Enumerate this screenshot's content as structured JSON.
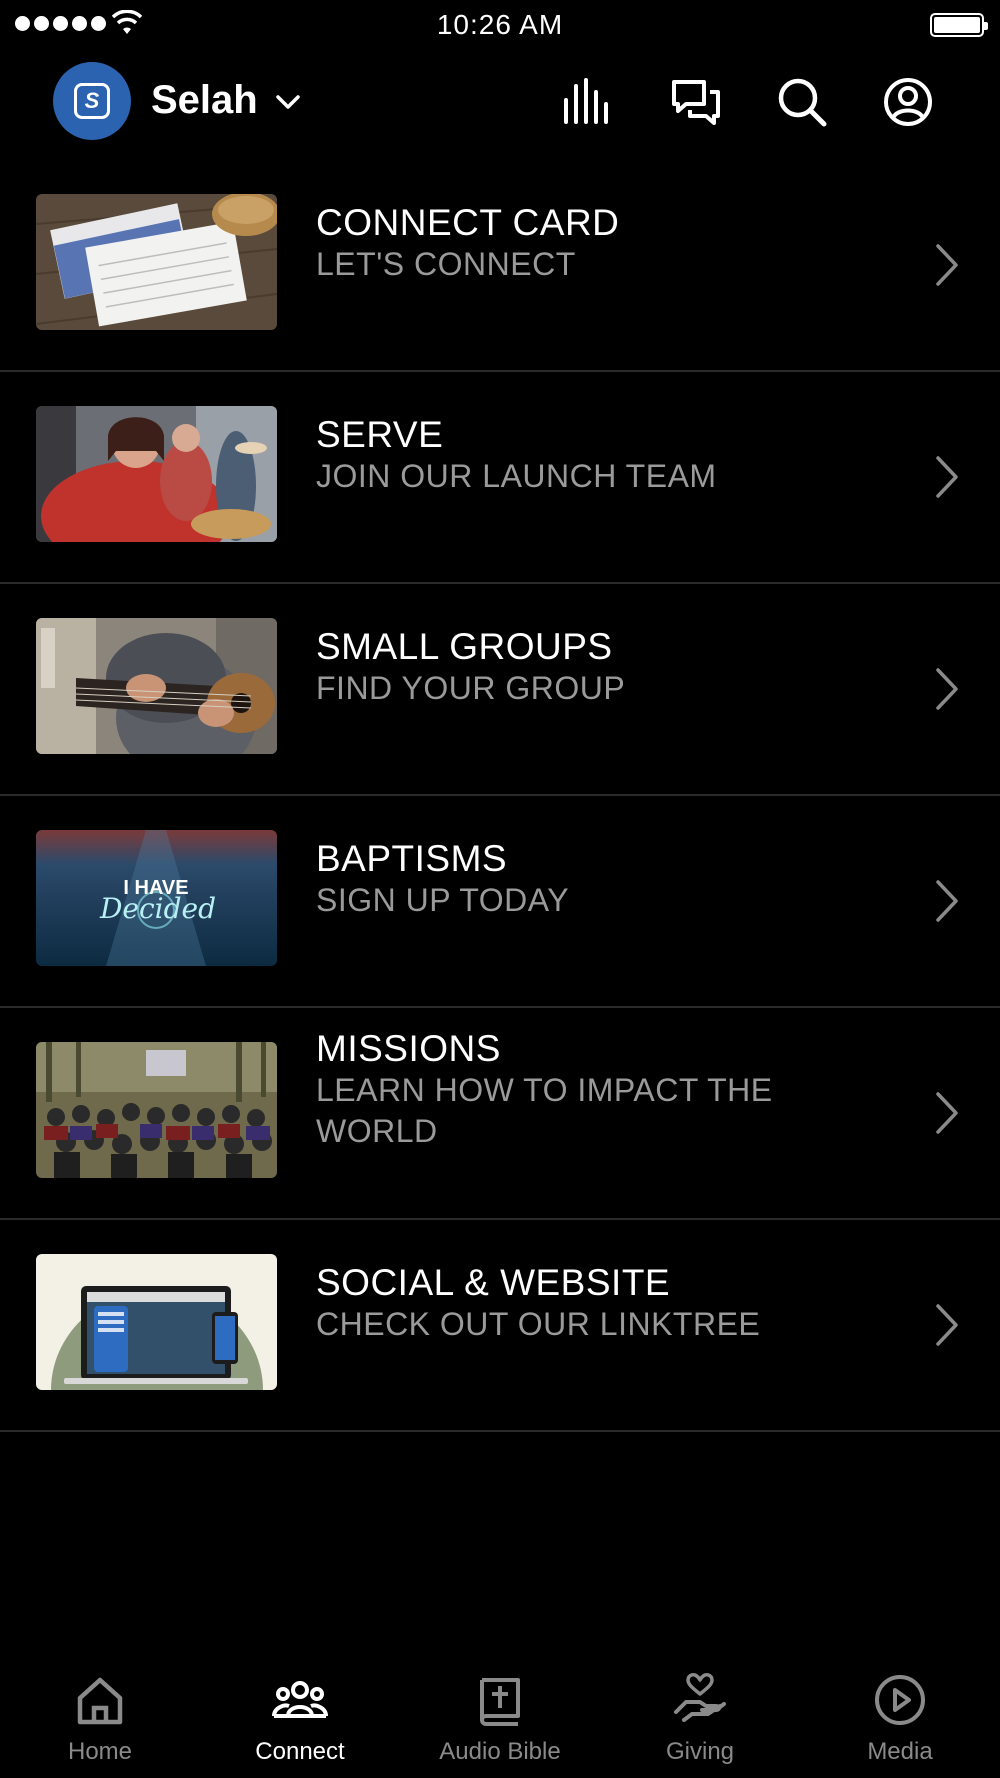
{
  "status_bar": {
    "time": "10:26 AM"
  },
  "header": {
    "avatar_letter": "S",
    "org_name": "Selah",
    "brand_color": "#2b63b0",
    "icons": [
      "audio-bars-icon",
      "chat-icon",
      "search-icon",
      "account-icon"
    ]
  },
  "list": {
    "items": [
      {
        "title": "CONNECT CARD",
        "subtitle": "LET'S CONNECT"
      },
      {
        "title": "SERVE",
        "subtitle": "JOIN OUR LAUNCH TEAM"
      },
      {
        "title": "SMALL GROUPS",
        "subtitle": "FIND YOUR GROUP"
      },
      {
        "title": "BAPTISMS",
        "subtitle": "SIGN UP TODAY",
        "thumb_text": "I HAVE",
        "thumb_script": "Decided"
      },
      {
        "title": "MISSIONS",
        "subtitle": "LEARN HOW TO IMPACT THE WORLD"
      },
      {
        "title": "SOCIAL & WEBSITE",
        "subtitle": "CHECK OUT OUR LINKTREE"
      }
    ]
  },
  "tabbar": {
    "tabs": [
      {
        "label": "Home",
        "icon": "home-icon"
      },
      {
        "label": "Connect",
        "icon": "people-icon",
        "active": true
      },
      {
        "label": "Audio Bible",
        "icon": "bible-icon"
      },
      {
        "label": "Giving",
        "icon": "giving-hand-icon"
      },
      {
        "label": "Media",
        "icon": "play-circle-icon"
      }
    ]
  }
}
